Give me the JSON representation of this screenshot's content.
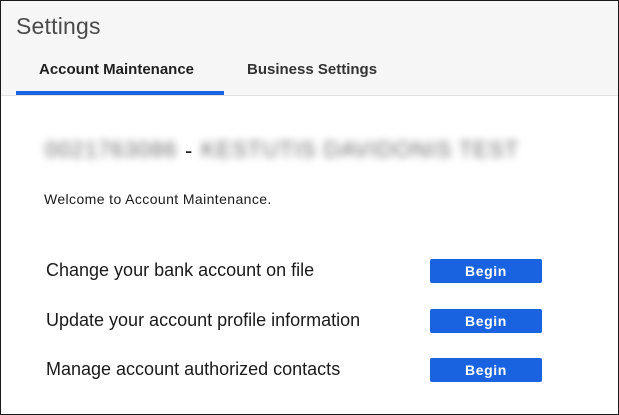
{
  "header": {
    "title": "Settings",
    "tabs": [
      {
        "label": "Account Maintenance",
        "active": true
      },
      {
        "label": "Business Settings",
        "active": false
      }
    ],
    "accent_color": "#1a63e0"
  },
  "account": {
    "id_redacted": "0021763086",
    "separator": "-",
    "name_redacted": "KESTUTIS DAVIDONIS TEST"
  },
  "main": {
    "welcome": "Welcome to Account Maintenance.",
    "actions": [
      {
        "label": "Change your bank account on file",
        "button": "Begin"
      },
      {
        "label": "Update your account profile information",
        "button": "Begin"
      },
      {
        "label": "Manage account authorized contacts",
        "button": "Begin"
      }
    ]
  }
}
